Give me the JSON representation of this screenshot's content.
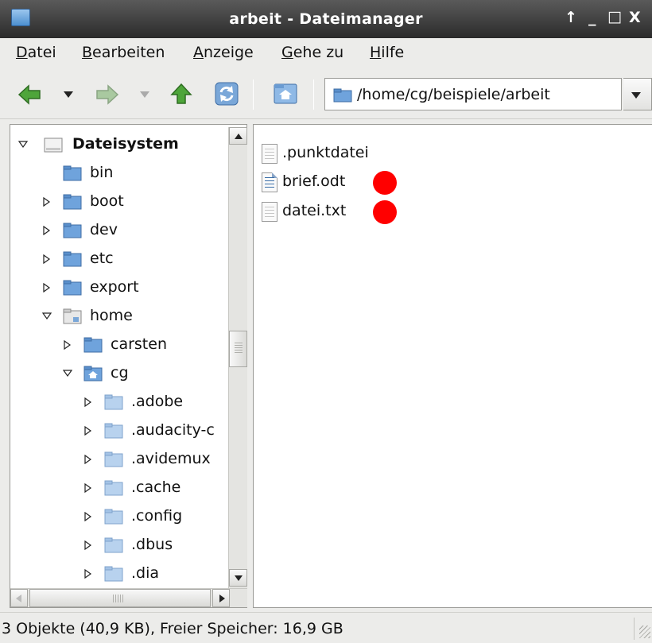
{
  "window": {
    "title": "arbeit - Dateimanager",
    "controls": {
      "up": "↑",
      "minimize": "_",
      "maximize": "□",
      "close": "X"
    }
  },
  "menu": [
    {
      "label": "Datei",
      "mnemonic": "D",
      "rest": "atei"
    },
    {
      "label": "Bearbeiten",
      "mnemonic": "B",
      "rest": "earbeiten"
    },
    {
      "label": "Anzeige",
      "mnemonic": "A",
      "rest": "nzeige"
    },
    {
      "label": "Gehe zu",
      "mnemonic": "G",
      "rest": "ehe zu"
    },
    {
      "label": "Hilfe",
      "mnemonic": "H",
      "rest": "ilfe"
    }
  ],
  "toolbar": {
    "back_icon": "back-arrow-icon",
    "forward_icon": "forward-arrow-icon",
    "up_icon": "up-arrow-icon",
    "reload_icon": "reload-icon",
    "home_icon": "home-folder-icon",
    "location": "/home/cg/beispiele/arbeit",
    "colors": {
      "arrow_green": "#4ea53a",
      "arrow_disabled": "#a9c9a0",
      "folder_blue": "#6fa3dc"
    }
  },
  "tree": {
    "root": "Dateisystem",
    "items": [
      {
        "label": "bin"
      },
      {
        "label": "boot"
      },
      {
        "label": "dev"
      },
      {
        "label": "etc"
      },
      {
        "label": "export"
      },
      {
        "label": "home"
      },
      {
        "label": "carsten"
      },
      {
        "label": "cg"
      },
      {
        "label": ".adobe"
      },
      {
        "label": ".audacity-c"
      },
      {
        "label": ".avidemux"
      },
      {
        "label": ".cache"
      },
      {
        "label": ".config"
      },
      {
        "label": ".dbus"
      },
      {
        "label": ".dia"
      }
    ]
  },
  "files": [
    {
      "name": ".punktdatei",
      "icon": "text-file-icon",
      "marked": false
    },
    {
      "name": "brief.odt",
      "icon": "document-file-icon",
      "marked": true
    },
    {
      "name": "datei.txt",
      "icon": "text-file-icon",
      "marked": true
    }
  ],
  "status": {
    "text": "3 Objekte (40,9 KB), Freier Speicher: 16,9 GB"
  },
  "colors": {
    "marker": "#ff0000",
    "titlebar": "#3a3a3a"
  }
}
